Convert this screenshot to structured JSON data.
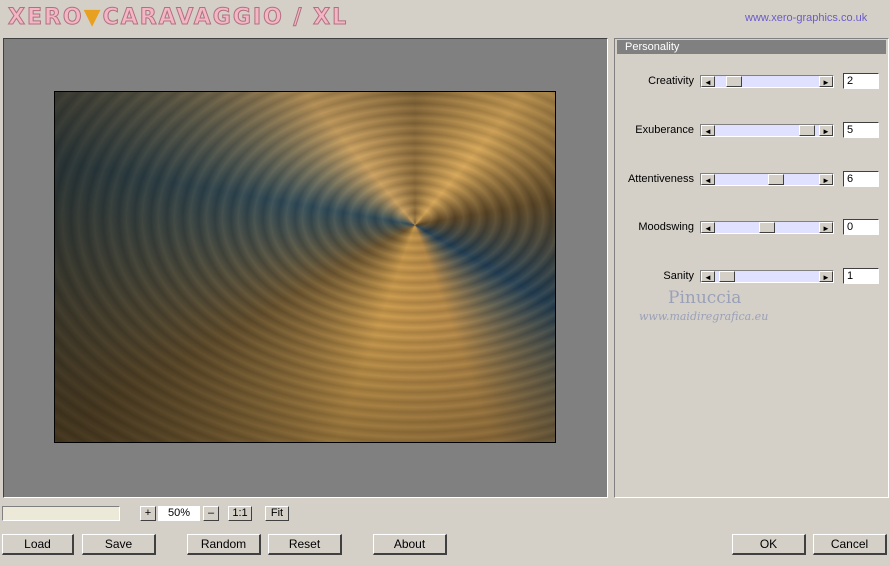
{
  "header": {
    "logo": {
      "part1": "XERO",
      "separator": "▼",
      "part2": "CARAVAGGIO / XL"
    },
    "url": "www.xero-graphics.co.uk"
  },
  "panel": {
    "title": "Personality",
    "sliders": [
      {
        "label": "Creativity",
        "value": "2",
        "level": 0.12
      },
      {
        "label": "Exuberance",
        "value": "5",
        "level": 0.95
      },
      {
        "label": "Attentiveness",
        "value": "6",
        "level": 0.6
      },
      {
        "label": "Moodswing",
        "value": "0",
        "level": 0.5
      },
      {
        "label": "Sanity",
        "value": "1",
        "level": 0.05
      }
    ]
  },
  "watermark": {
    "line1": "Pinuccia",
    "line2": "www.maidiregrafica.eu"
  },
  "zoom": {
    "plus": "+",
    "value": "50%",
    "minus": "–",
    "one_to_one": "1:1",
    "fit": "Fit"
  },
  "buttons": {
    "load": "Load",
    "save": "Save",
    "random": "Random",
    "reset": "Reset",
    "about": "About",
    "ok": "OK",
    "cancel": "Cancel"
  },
  "icons": {
    "left_arrow": "◄",
    "right_arrow": "►"
  }
}
